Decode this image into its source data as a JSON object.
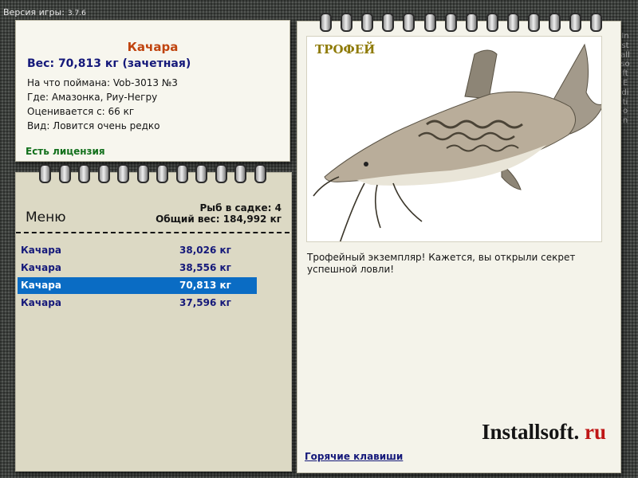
{
  "header": {
    "version_label": "Версия игры:",
    "version_number": "3.7.6"
  },
  "info": {
    "title": "Качара",
    "weight": "Вес: 70,813 кг (зачетная)",
    "caught_with": "На что поймана: Vob-3013 №3",
    "location": "Где: Амазонка, Риу-Негру",
    "value": "Оценивается с: 66 кг",
    "rarity": "Вид: Ловится очень редко",
    "license": "Есть лицензия"
  },
  "menu": {
    "label": "Меню",
    "fish_count": "Рыб в садке: 4",
    "total_weight": "Общий вес: 184,992 кг",
    "items": [
      {
        "name": "Качара",
        "weight": "38,026 кг"
      },
      {
        "name": "Качара",
        "weight": "38,556 кг"
      },
      {
        "name": "Качара",
        "weight": "70,813 кг"
      },
      {
        "name": "Качара",
        "weight": "37,596 кг"
      }
    ],
    "selected_index": 2
  },
  "trophy": {
    "label": "ТРОФЕЙ",
    "caption": "Трофейный экземпляр! Кажется, вы открыли секрет успешной ловли!",
    "hotkeys_link": "Горячие клавиши",
    "logo_main": "Installsoft.",
    "logo_ru": "ru"
  },
  "side_text": "Installsoft Edition",
  "colors": {
    "accent_orange": "#c0440f",
    "link_blue": "#15197a",
    "license_green": "#12701c",
    "selection_blue": "#0a6cc4",
    "trophy_gold": "#8f7b08"
  }
}
